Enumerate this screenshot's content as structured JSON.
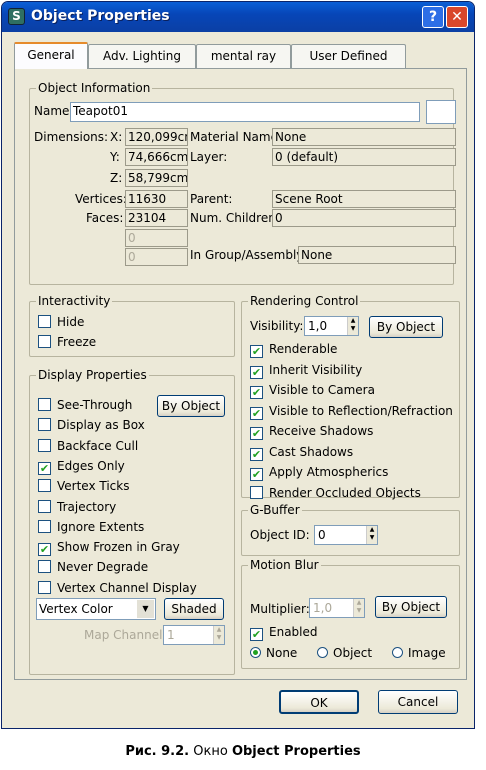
{
  "window": {
    "title": "Object Properties",
    "help_label": "?",
    "close_label": "✕"
  },
  "tabs": [
    {
      "label": "General"
    },
    {
      "label": "Adv. Lighting"
    },
    {
      "label": "mental ray"
    },
    {
      "label": "User Defined"
    }
  ],
  "object_info": {
    "group_title": "Object Information",
    "name_label": "Name:",
    "name_value": "Teapot01",
    "dimensions_label": "Dimensions:",
    "x_label": "X:",
    "x_value": "120,099cm",
    "y_label": "Y:",
    "y_value": "74,666cm",
    "z_label": "Z:",
    "z_value": "58,799cm",
    "vertices_label": "Vertices:",
    "vertices_value": "11630",
    "faces_label": "Faces:",
    "faces_value": "23104",
    "extra1": "0",
    "extra2": "0",
    "material_label": "Material Name:",
    "material_value": "None",
    "layer_label": "Layer:",
    "layer_value": "0 (default)",
    "parent_label": "Parent:",
    "parent_value": "Scene Root",
    "children_label": "Num. Children:",
    "children_value": "0",
    "group_label": "In Group/Assembly:",
    "group_value": "None"
  },
  "interactivity": {
    "title": "Interactivity",
    "hide": "Hide",
    "freeze": "Freeze"
  },
  "display": {
    "title": "Display Properties",
    "by_object": "By Object",
    "items": [
      {
        "label": "See-Through",
        "checked": false
      },
      {
        "label": "Display as Box",
        "checked": false
      },
      {
        "label": "Backface Cull",
        "checked": false
      },
      {
        "label": "Edges Only",
        "checked": true
      },
      {
        "label": "Vertex Ticks",
        "checked": false
      },
      {
        "label": "Trajectory",
        "checked": false
      },
      {
        "label": "Ignore Extents",
        "checked": false
      },
      {
        "label": "Show Frozen in Gray",
        "checked": true
      },
      {
        "label": "Never Degrade",
        "checked": false
      },
      {
        "label": "Vertex Channel Display",
        "checked": false
      }
    ],
    "vertex_color": "Vertex Color",
    "shaded": "Shaded",
    "map_channel_label": "Map Channel:",
    "map_channel_value": "1"
  },
  "rendering": {
    "title": "Rendering Control",
    "visibility_label": "Visibility:",
    "visibility_value": "1,0",
    "by_object": "By Object",
    "items": [
      {
        "label": "Renderable",
        "checked": true
      },
      {
        "label": "Inherit Visibility",
        "checked": true
      },
      {
        "label": "Visible to Camera",
        "checked": true
      },
      {
        "label": "Visible to Reflection/Refraction",
        "checked": true
      },
      {
        "label": "Receive Shadows",
        "checked": true
      },
      {
        "label": "Cast Shadows",
        "checked": true
      },
      {
        "label": "Apply Atmospherics",
        "checked": true
      },
      {
        "label": "Render Occluded Objects",
        "checked": false
      }
    ]
  },
  "gbuffer": {
    "title": "G-Buffer",
    "object_id_label": "Object ID:",
    "object_id_value": "0"
  },
  "motion_blur": {
    "title": "Motion Blur",
    "multiplier_label": "Multiplier:",
    "multiplier_value": "1,0",
    "by_object": "By Object",
    "enabled": "Enabled",
    "none": "None",
    "object": "Object",
    "image": "Image"
  },
  "buttons": {
    "ok": "OK",
    "cancel": "Cancel"
  },
  "caption": {
    "prefix": "Рис. 9.2.",
    "text": "Окно",
    "bold": "Object Properties"
  }
}
